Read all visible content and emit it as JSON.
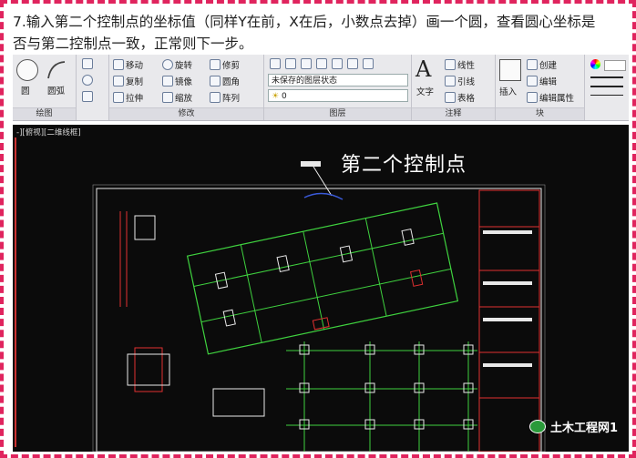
{
  "caption": {
    "line1": "7.输入第二个控制点的坐标值（同样Y在前，X在后，小数点去掉）画一个圆，查看圆心坐标是",
    "line2": "否与第二控制点一致，正常则下一步。"
  },
  "ribbon": {
    "draw": {
      "label": "绘图",
      "circle": "圆",
      "arc": "圆弧"
    },
    "modify": {
      "label": "修改",
      "move": "移动",
      "rotate": "旋转",
      "trim": "修剪",
      "copy": "复制",
      "mirror": "镜像",
      "fillet": "圆角",
      "stretch": "拉伸",
      "scale": "缩放",
      "array": "阵列"
    },
    "layers": {
      "label": "图层",
      "state": "未保存的图层状态",
      "current": "0"
    },
    "annotation": {
      "label": "注释",
      "text": "文字",
      "linear": "线性",
      "leader": "引线",
      "table": "表格"
    },
    "block": {
      "label": "块",
      "insert": "插入",
      "create": "创建",
      "edit": "编辑",
      "edit_attr": "编辑属性"
    }
  },
  "viewport": {
    "label": "-][俯视][二维线框]",
    "callout": "第二个控制点"
  },
  "watermark": "土木工程网1",
  "colors": {
    "frame": "#e0245e",
    "canvas_bg": "#0b0b0b",
    "cad_green": "#3fd23f",
    "cad_cyan": "#2fd6e0",
    "cad_red": "#e03030",
    "cad_yellow": "#e0d23a"
  }
}
